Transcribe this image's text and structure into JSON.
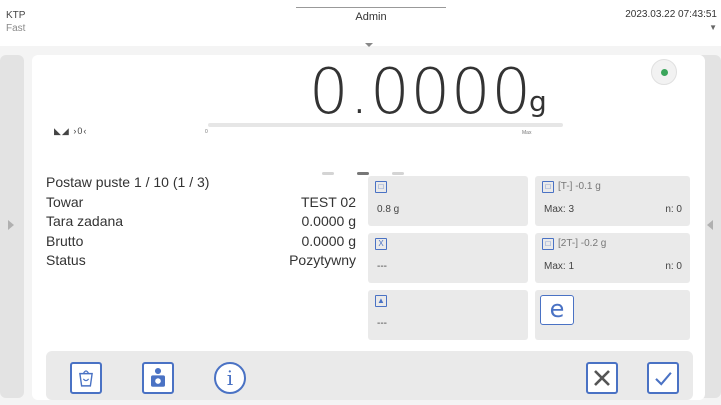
{
  "status_bar": {
    "device": "KTP",
    "mode": "Fast",
    "user": "Admin",
    "datetime": "2023.03.22 07:43:51"
  },
  "display": {
    "weight": "0.0000",
    "unit": "g",
    "zero_indicator": "◣◢ ›0‹",
    "bar_min_label": "0",
    "bar_max_label": "Max",
    "bar_fill_fraction": 0.0,
    "stability_color": "#3aa55b"
  },
  "pager": {
    "pages": 3,
    "active": 1
  },
  "info": [
    {
      "key": "Postaw puste 1 / 10 (1 / 3)",
      "value": ""
    },
    {
      "key": "Towar",
      "value": "TEST 02"
    },
    {
      "key": "Tara zadana",
      "value": "0.0000 g"
    },
    {
      "key": "Brutto",
      "value": "0.0000 g"
    },
    {
      "key": "Status",
      "value": "Pozytywny"
    }
  ],
  "tiles": {
    "t1": {
      "icon": "tare-icon",
      "value": "0.8 g"
    },
    "t2": {
      "icon": "x-bar-icon",
      "value": "---"
    },
    "t3": {
      "icon": "weight-icon",
      "value": "---"
    },
    "t4": {
      "icon": "tare-list-icon",
      "header": "[T-]  -0.1 g",
      "max": "Max: 3",
      "n": "n: 0"
    },
    "t5": {
      "icon": "tare-list-2-icon",
      "header": "[2T-]  -0.2 g",
      "max": "Max: 1",
      "n": "n: 0"
    },
    "t6": {
      "icon": "e-icon",
      "value": "e"
    }
  },
  "toolbar": {
    "left_buttons": [
      "container-tare-icon",
      "camera-icon",
      "info-icon"
    ],
    "info_label": "i",
    "right_buttons": [
      "close-icon",
      "confirm-icon"
    ]
  },
  "colors": {
    "accent": "#4a72c4",
    "ok": "#3aa55b"
  }
}
